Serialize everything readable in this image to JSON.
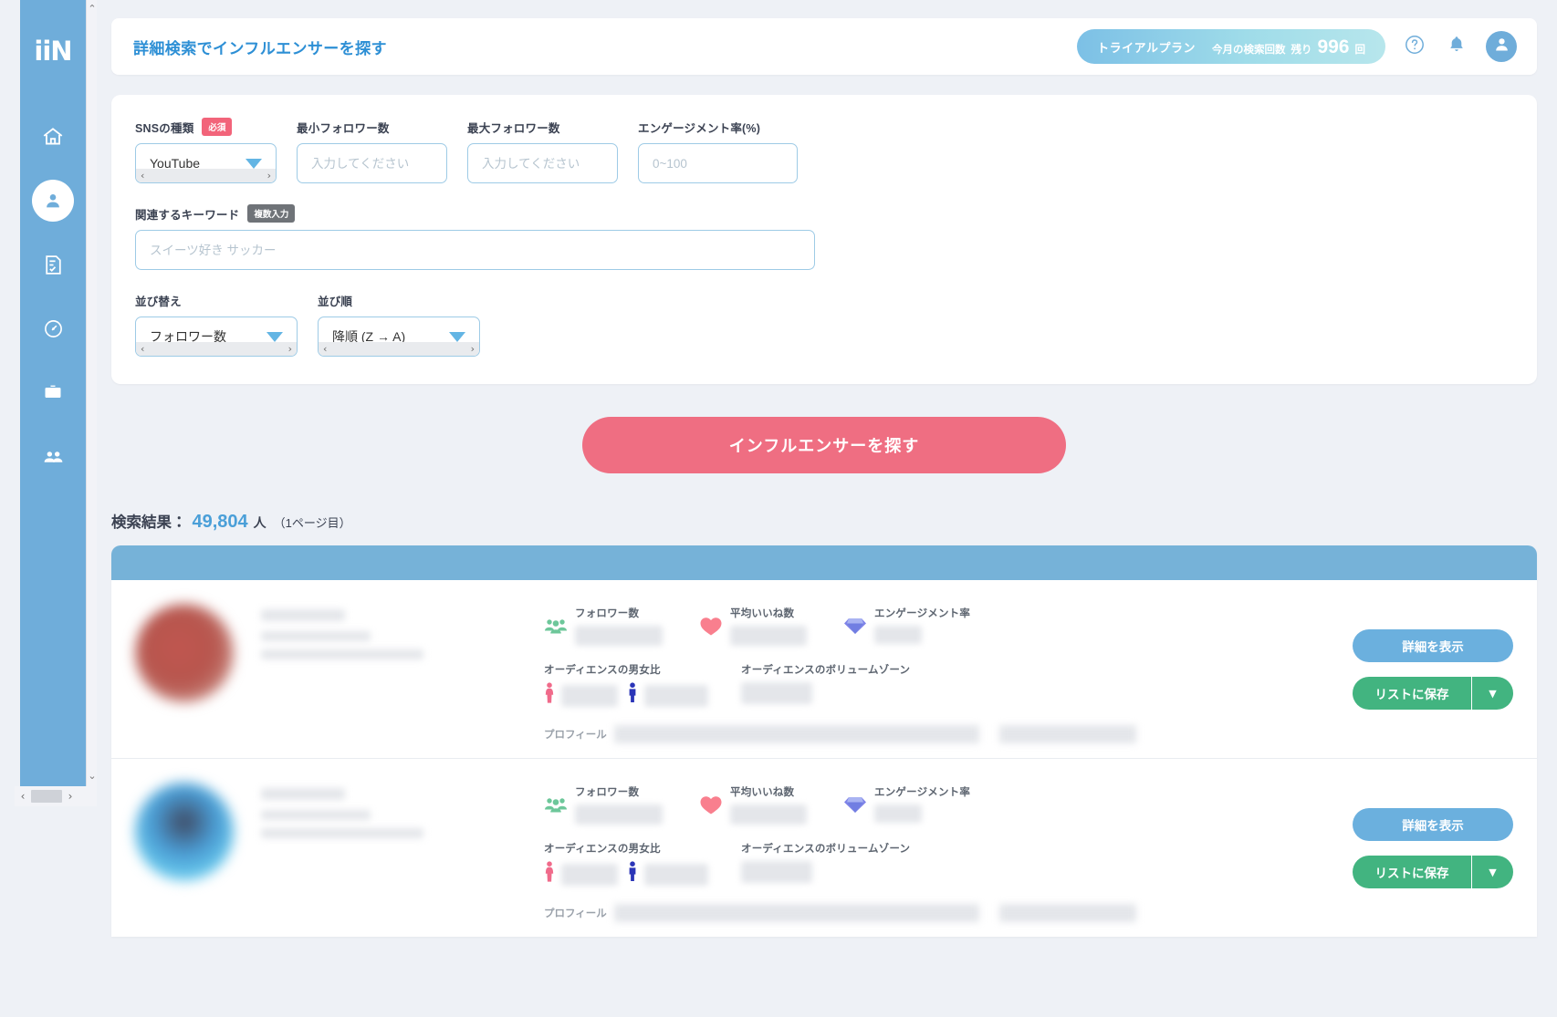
{
  "sidebar": {
    "logo": "iiN",
    "items": [
      {
        "name": "home",
        "icon": "home-icon",
        "active": false
      },
      {
        "name": "influencer",
        "icon": "person-icon",
        "active": true
      },
      {
        "name": "list",
        "icon": "document-check-icon",
        "active": false
      },
      {
        "name": "analytics",
        "icon": "gauge-icon",
        "active": false
      },
      {
        "name": "projects",
        "icon": "briefcase-icon",
        "active": false
      },
      {
        "name": "team",
        "icon": "people-icon",
        "active": false
      }
    ],
    "scroll_left_arrow": "‹",
    "scroll_right_arrow": "›",
    "scroll_up_arrow": "⌃",
    "scroll_down_arrow": "⌄"
  },
  "header": {
    "title": "詳細検索でインフルエンサーを探す",
    "plan_name": "トライアルプラン",
    "quota_label": "今月の検索回数",
    "quota_prefix": "残り",
    "quota_count": "996",
    "quota_unit": "回",
    "help_icon": "question-circle-icon",
    "bell_icon": "bell-icon",
    "avatar_icon": "user-avatar-icon"
  },
  "search_form": {
    "sns_type": {
      "label": "SNSの種類",
      "required_tag": "必須",
      "value": "YouTube"
    },
    "min_followers": {
      "label": "最小フォロワー数",
      "placeholder": "入力してください",
      "value": ""
    },
    "max_followers": {
      "label": "最大フォロワー数",
      "placeholder": "入力してください",
      "value": ""
    },
    "engagement_rate": {
      "label": "エンゲージメント率(%)",
      "placeholder": "0~100",
      "value": ""
    },
    "keyword": {
      "label": "関連するキーワード",
      "multi_tag": "複数入力",
      "placeholder": "スイーツ好き サッカー",
      "value": ""
    },
    "sort_by": {
      "label": "並び替え",
      "value": "フォロワー数"
    },
    "sort_order": {
      "label": "並び順",
      "value": "降順 (Z → A)"
    },
    "submit_label": "インフルエンサーを探す"
  },
  "results": {
    "count_label": "検索結果：",
    "count": "49,804",
    "count_unit": "人",
    "page_note": "（1ページ目）",
    "metric_labels": {
      "followers": "フォロワー数",
      "avg_likes": "平均いいね数",
      "engagement": "エンゲージメント率",
      "gender_ratio": "オーディエンスの男女比",
      "volume_zone": "オーディエンスのボリュームゾーン",
      "profile": "プロフィール"
    },
    "metric_icons": {
      "followers": "group-people-icon",
      "avg_likes": "heart-icon",
      "engagement": "diamond-icon",
      "female": "female-figure-icon",
      "male": "male-figure-icon"
    },
    "actions": {
      "detail_label": "詳細を表示",
      "save_label": "リストに保存",
      "save_caret": "▼"
    },
    "rows": [
      {
        "avatar_style": "avatar-a"
      },
      {
        "avatar_style": "avatar-b"
      }
    ]
  },
  "colors": {
    "sidebar_blue": "#6fadda",
    "title_blue": "#2d8fd5",
    "accent_pink": "#ef6e82",
    "detail_blue": "#6bb0de",
    "save_green": "#42b480",
    "required_red": "#f2647a",
    "page_bg": "#eef1f6"
  }
}
